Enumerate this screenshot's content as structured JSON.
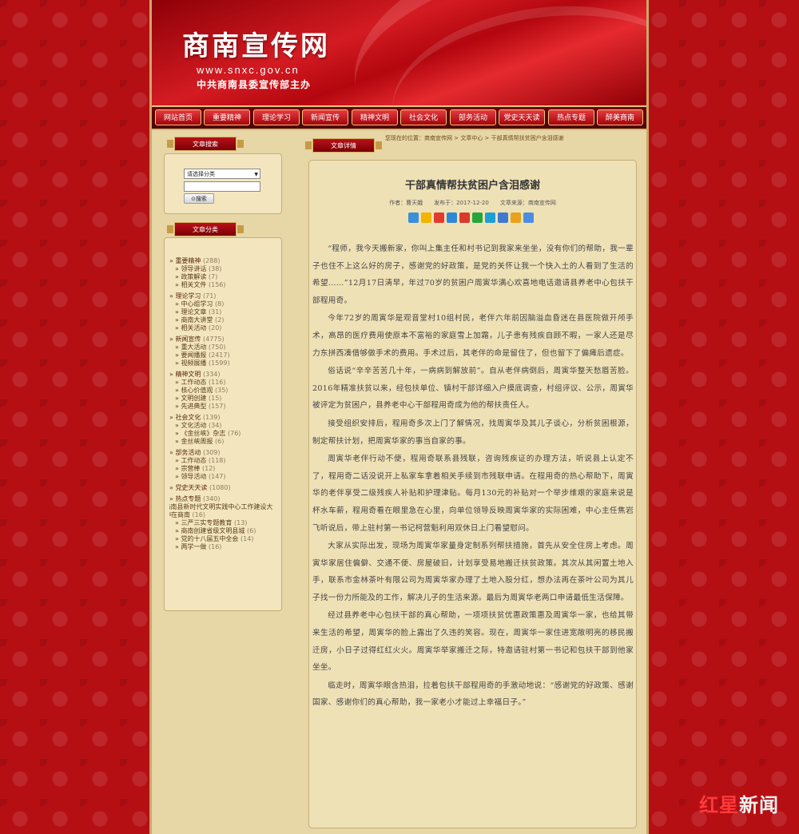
{
  "header": {
    "title": "商南宣传网",
    "url": "www.snxc.gov.cn",
    "org": "中共商南县委宣传部主办"
  },
  "nav": [
    "网站首页",
    "重要精神",
    "理论学习",
    "新闻宣传",
    "精神文明",
    "社会文化",
    "部务活动",
    "党史天天读",
    "热点专题",
    "醉美商南"
  ],
  "sidebar": {
    "search_title": "文章搜索",
    "select_value": "请选择分类",
    "search_button": "搜索",
    "categories_title": "文章分类",
    "categories": [
      {
        "label": "重要精神",
        "count": "(288)",
        "subs": [
          {
            "label": "领导讲话",
            "count": "(38)"
          },
          {
            "label": "政策解读",
            "count": "(7)"
          },
          {
            "label": "相关文件",
            "count": "(156)"
          }
        ]
      },
      {
        "label": "理论学习",
        "count": "(71)",
        "subs": [
          {
            "label": "中心组学习",
            "count": "(8)"
          },
          {
            "label": "理论文章",
            "count": "(31)"
          },
          {
            "label": "商南大讲堂",
            "count": "(2)"
          },
          {
            "label": "相关活动",
            "count": "(20)"
          }
        ]
      },
      {
        "label": "新闻宣传",
        "count": "(4775)",
        "subs": [
          {
            "label": "重大活动",
            "count": "(750)"
          },
          {
            "label": "要闻播报",
            "count": "(2417)"
          },
          {
            "label": "视频展播",
            "count": "(1599)"
          }
        ]
      },
      {
        "label": "精神文明",
        "count": "(334)",
        "subs": [
          {
            "label": "工作动态",
            "count": "(116)"
          },
          {
            "label": "核心价值观",
            "count": "(35)"
          },
          {
            "label": "文明创建",
            "count": "(15)"
          },
          {
            "label": "先进典型",
            "count": "(157)"
          }
        ]
      },
      {
        "label": "社会文化",
        "count": "(139)",
        "subs": [
          {
            "label": "文化活动",
            "count": "(34)"
          },
          {
            "label": "《金丝峡》杂志",
            "count": "(76)"
          },
          {
            "label": "金丝峡周报",
            "count": "(6)"
          }
        ]
      },
      {
        "label": "部务活动",
        "count": "(309)",
        "subs": [
          {
            "label": "工作动态",
            "count": "(118)"
          },
          {
            "label": "宗营棒",
            "count": "(12)"
          },
          {
            "label": "领导活动",
            "count": "(147)"
          }
        ]
      },
      {
        "label": "党史天天读",
        "count": "(1080)",
        "subs": []
      },
      {
        "label": "热点专题",
        "count": "(340)",
        "subs": [
          {
            "label": "商南县新时代文明实践中心工作建设大精神在商南",
            "count": "(16)",
            "long": true
          },
          {
            "label": "三严三实专题教育",
            "count": "(13)"
          },
          {
            "label": "商南创建省级文明县城",
            "count": "(6)"
          },
          {
            "label": "党的十八届五中全会",
            "count": "(14)"
          },
          {
            "label": "两学一做",
            "count": "(16)"
          }
        ]
      }
    ]
  },
  "main": {
    "section_title": "文章详情",
    "breadcrumb": "您现在的位置：商南宣传网 > 文章中心 > 干部真情帮扶贫困户含泪感谢",
    "title": "干部真情帮扶贫困户含泪感谢",
    "meta": "作者：曹天娥　　发布于：2017-12-20　　文章来源：商南宣传网",
    "paragraphs": [
      "“程师，我今天搬新家，你叫上集主任和村书记到我家来坐坐，没有你们的帮助，我一辈子也住不上这么好的房子，感谢党的好政策，是党的关怀让我一个快入土的人看到了生活的希望……”12月17日清早，年过70岁的贫困户周寅华满心欢喜地电话邀请县养老中心包扶干部程用奇。",
      "今年72岁的周寅华是观音堂村10组村民，老伴六年前因脑溢血昏迷在县医院做开颅手术，高昂的医疗费用使原本不富裕的家庭雪上加霜，儿子患有残疾自顾不暇，一家人还是尽力东拼西凑借够做手术的费用。手术过后，其老伴的命是留住了，但也留下了偏瘫后遗症。",
      "俗话说“辛辛苦苦几十年，一病病到解放前”。自从老伴病倒后，周寅华整天愁眉苦脸。2016年精准扶贫以来，经包扶单位、镇村干部详细入户摸底调查，村组评议、公示，周寅华被评定为贫困户，县养老中心干部程用奇成为他的帮扶责任人。",
      "接受组织安排后，程用奇多次上门了解情况，找周寅华及其儿子谈心，分析贫困根源，制定帮扶计划，把周寅华家的事当自家的事。",
      "周寅华老伴行动不便，程用奇联系县残联，咨询残疾证的办理方法，听说县上认定不了，程用奇二话没说开上私家车拿着相关手续到市残联申请。在程用奇的热心帮助下，周寅华的老伴享受二级残疾人补贴和护理津贴。每月130元的补贴对一个举步维艰的家庭来说是杯水车薪，程用奇看在眼里急在心里，向单位领导反映周寅华家的实际困难，中心主任焦岩飞听说后，带上驻村第一书记柯营魁利用双休日上门看望慰问。",
      "大家从实际出发，现场为周寅华家量身定制系列帮扶措施，首先从安全住房上考虑。周寅华家居住偏僻、交通不便、房屋破旧，计划享受易地搬迁扶贫政策。其次从其闲置土地入手，联系市金林茶叶有限公司为周寅华家办理了土地入股分红，想办法再在茶叶公司为其儿子找一份力所能及的工作，解决儿子的生活来源。最后为周寅华老两口申请最低生活保障。",
      "经过县养老中心包扶干部的真心帮助，一项项扶贫优惠政策惠及周寅华一家，也给其带来生活的希望，周寅华的脸上露出了久违的笑容。现在，周寅华一家住进宽敞明亮的移民搬迁房，小日子过得红红火火。周寅华举家搬迁之际，特邀请驻村第一书记和包扶干部到他家坐坐。",
      "临走时，周寅华眼含热泪，拉着包扶干部程用奇的手激动地说：“感谢党的好政策、感谢国家、感谢你们的真心帮助，我一家老小才能过上幸福日子。”"
    ]
  },
  "watermark": {
    "brand_red": "红星",
    "brand_white": "新闻"
  },
  "colors": {
    "background": "#b50f14",
    "page": "#e7d6a6",
    "accent": "#d7b66c"
  }
}
